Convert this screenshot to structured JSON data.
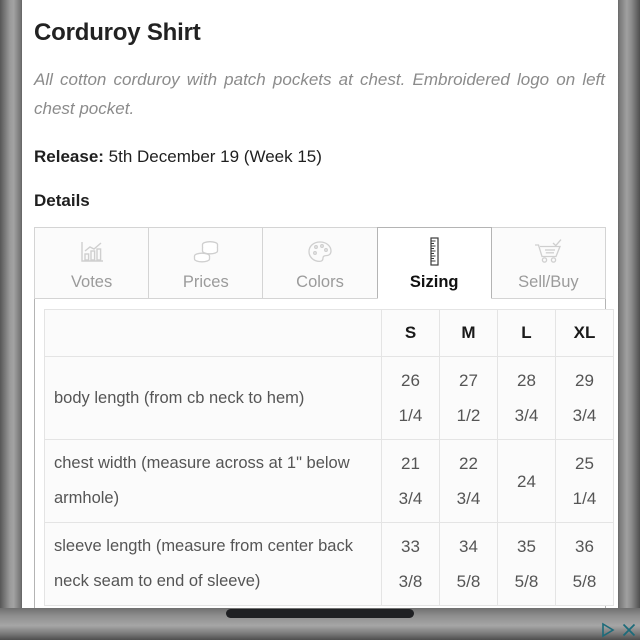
{
  "product": {
    "title": "Corduroy Shirt",
    "description": "All cotton corduroy with patch pockets at chest. Embroidered logo on left chest pocket.",
    "release_label": "Release:",
    "release_value": "5th December 19 (Week 15)",
    "details_heading": "Details"
  },
  "tabs": [
    {
      "label": "Votes",
      "icon": "bar-chart-icon",
      "active": false
    },
    {
      "label": "Prices",
      "icon": "coins-icon",
      "active": false
    },
    {
      "label": "Colors",
      "icon": "palette-icon",
      "active": false
    },
    {
      "label": "Sizing",
      "icon": "ruler-icon",
      "active": true
    },
    {
      "label": "Sell/Buy",
      "icon": "shopping-cart-check-icon",
      "active": false
    }
  ],
  "sizing_table": {
    "headers": [
      "",
      "S",
      "M",
      "L",
      "XL"
    ],
    "rows": [
      {
        "measurement": "body length (from cb neck to hem)",
        "values": [
          {
            "whole": "26",
            "frac": "1/4"
          },
          {
            "whole": "27",
            "frac": "1/2"
          },
          {
            "whole": "28",
            "frac": "3/4"
          },
          {
            "whole": "29",
            "frac": "3/4"
          }
        ]
      },
      {
        "measurement": "chest width (measure across at 1\" below armhole)",
        "values": [
          {
            "whole": "21",
            "frac": "3/4"
          },
          {
            "whole": "22",
            "frac": "3/4"
          },
          {
            "whole": "24",
            "frac": ""
          },
          {
            "whole": "25",
            "frac": "1/4"
          }
        ]
      },
      {
        "measurement": "sleeve length (measure from center back neck seam to end of sleeve)",
        "values": [
          {
            "whole": "33",
            "frac": "3/8"
          },
          {
            "whole": "34",
            "frac": "5/8"
          },
          {
            "whole": "35",
            "frac": "5/8"
          },
          {
            "whole": "36",
            "frac": "5/8"
          }
        ]
      }
    ]
  },
  "ad_overlay": {
    "play_icon": "adchoices-triangle-icon",
    "close_icon": "ad-close-icon",
    "color": "#1c6b7a"
  },
  "colors": {
    "title_text": "#222222",
    "description_text": "#8b8b8b",
    "tab_inactive_text": "#9b9b9b",
    "tab_active_text": "#111111",
    "icon_gray": "#cfcfcf",
    "table_border": "#e4e4e4",
    "panel_border": "#b4b4b4"
  },
  "system": {
    "home_indicator": "home-indicator-bar"
  }
}
